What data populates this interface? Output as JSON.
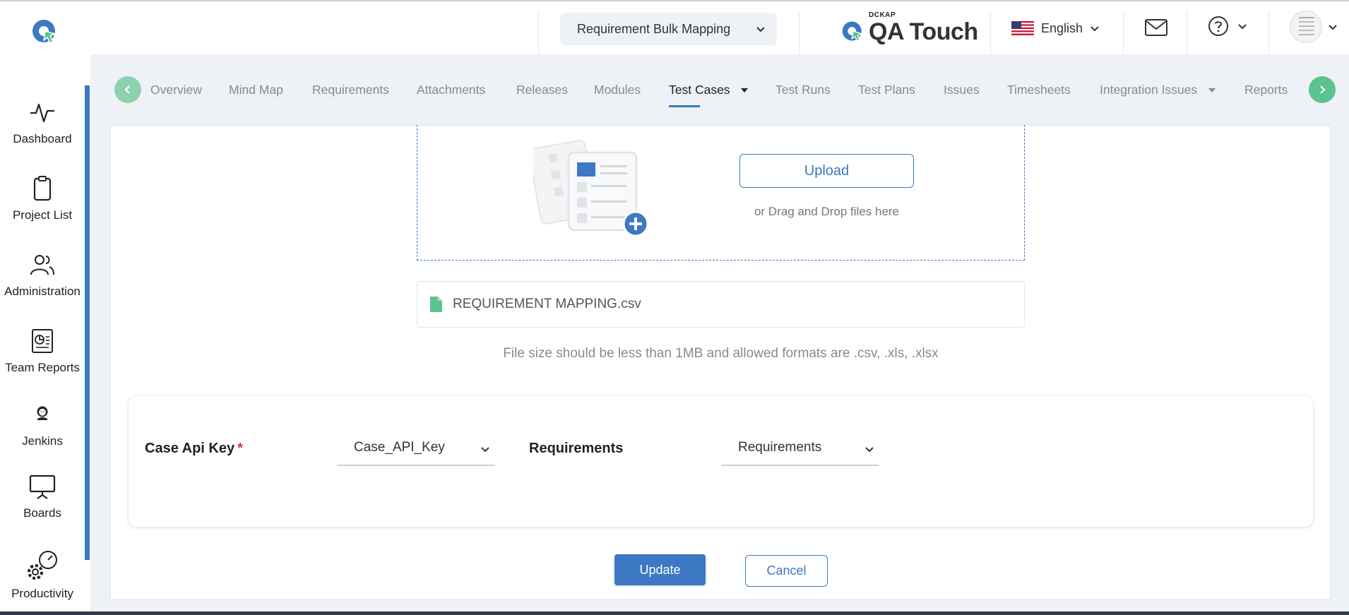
{
  "header": {
    "page_selector": "Requirement Bulk Mapping",
    "brand_small": "DCKAP",
    "brand_name": "QA Touch",
    "language": "English"
  },
  "sidebar": {
    "items": [
      {
        "label": "Dashboard",
        "icon": "activity-icon"
      },
      {
        "label": "Project List",
        "icon": "clipboard-icon"
      },
      {
        "label": "Administration",
        "icon": "users-icon"
      },
      {
        "label": "Team Reports",
        "icon": "report-icon"
      },
      {
        "label": "Jenkins",
        "icon": "jenkins-icon"
      },
      {
        "label": "Boards",
        "icon": "presentation-board-icon"
      },
      {
        "label": "Productivity",
        "icon": "gear-gauge-icon"
      }
    ]
  },
  "tabs": [
    {
      "label": "Overview"
    },
    {
      "label": "Mind Map"
    },
    {
      "label": "Requirements"
    },
    {
      "label": "Attachments"
    },
    {
      "label": "Releases"
    },
    {
      "label": "Modules"
    },
    {
      "label": "Test Cases",
      "active": true,
      "dropdown": true
    },
    {
      "label": "Test Runs"
    },
    {
      "label": "Test Plans"
    },
    {
      "label": "Issues"
    },
    {
      "label": "Timesheets"
    },
    {
      "label": "Integration Issues",
      "dropdown": true
    },
    {
      "label": "Reports"
    }
  ],
  "upload": {
    "button_label": "Upload",
    "drag_text": "or Drag and Drop files here",
    "file_name": "REQUIREMENT MAPPING.csv",
    "hint": "File size should be less than 1MB and allowed formats are .csv, .xls, .xlsx"
  },
  "mapping": {
    "case_api_key_label": "Case Api Key",
    "required_mark": "*",
    "case_api_key_value": "Case_API_Key",
    "requirements_label": "Requirements",
    "requirements_value": "Requirements"
  },
  "actions": {
    "update_label": "Update",
    "cancel_label": "Cancel"
  },
  "colors": {
    "accent": "#3c78c3",
    "nav_arrow": "#5cc28f",
    "content_bg": "#eef1f5",
    "required": "#d9342b"
  }
}
